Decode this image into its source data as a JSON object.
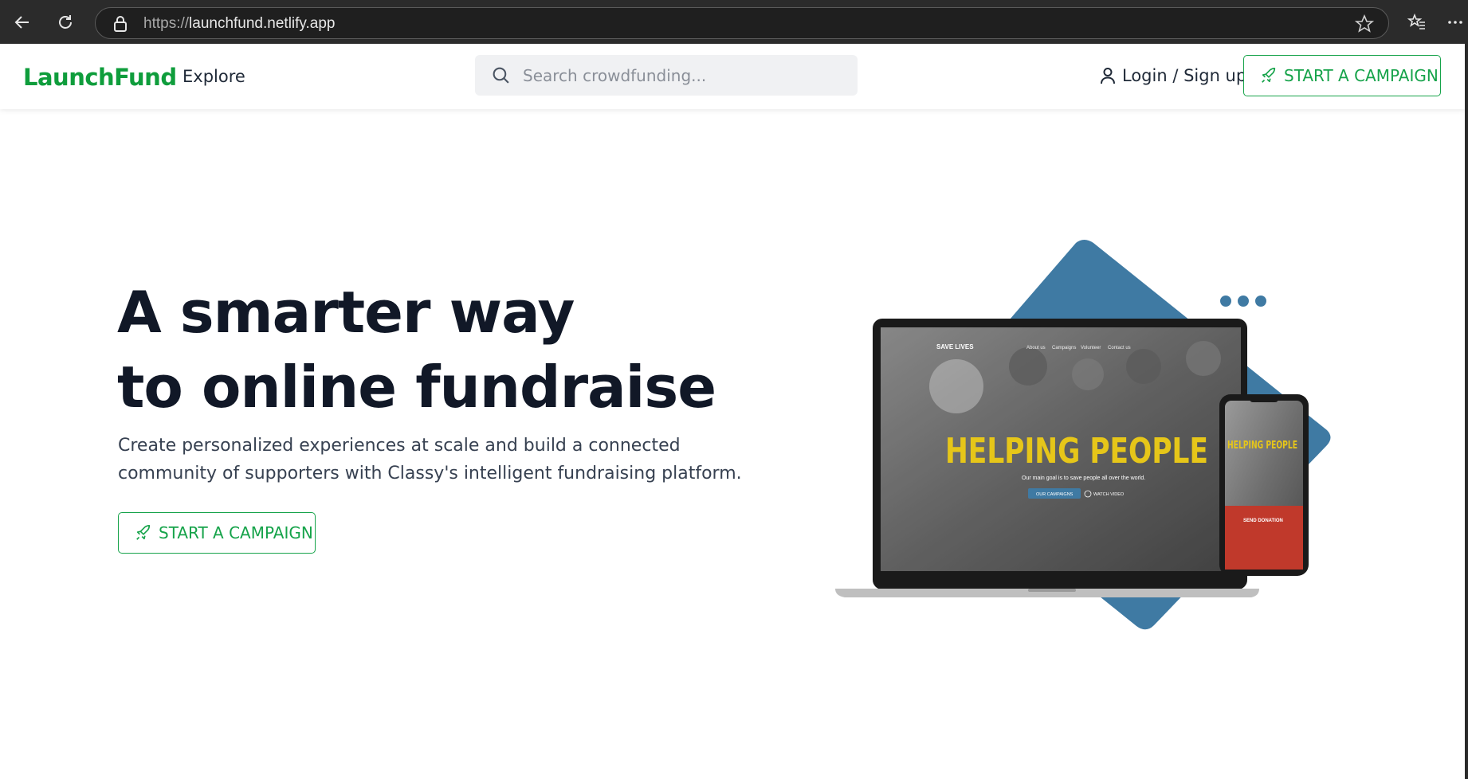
{
  "browser": {
    "url_protocol": "https://",
    "url_host": "launchfund.netlify.app"
  },
  "header": {
    "logo": "LaunchFund",
    "nav_explore": "Explore",
    "search_placeholder": "Search crowdfunding...",
    "login_label": "Login / Sign up",
    "cta_label": "START A CAMPAIGN"
  },
  "hero": {
    "title_line1": "A smarter way",
    "title_line2": "to online fundraise",
    "subtitle": "Create personalized experiences at scale and build a connected community of supporters with Classy's intelligent fundraising platform.",
    "cta_label": "START A CAMPAIGN"
  },
  "mockup": {
    "site_name": "SAVE LIVES",
    "nav": [
      "About us",
      "Campaigns",
      "Volunteer",
      "Contact us"
    ],
    "headline": "HELPING PEOPLE",
    "tagline": "Our main goal is to save people all over the world.",
    "btn_primary": "OUR CAMPAIGNS",
    "btn_secondary": "WATCH VIDEO",
    "phone_card": "SEND DONATION"
  },
  "colors": {
    "brand_green": "#16a34a",
    "diamond_blue": "#3f7aa3",
    "headline_yellow": "#e6c619"
  }
}
